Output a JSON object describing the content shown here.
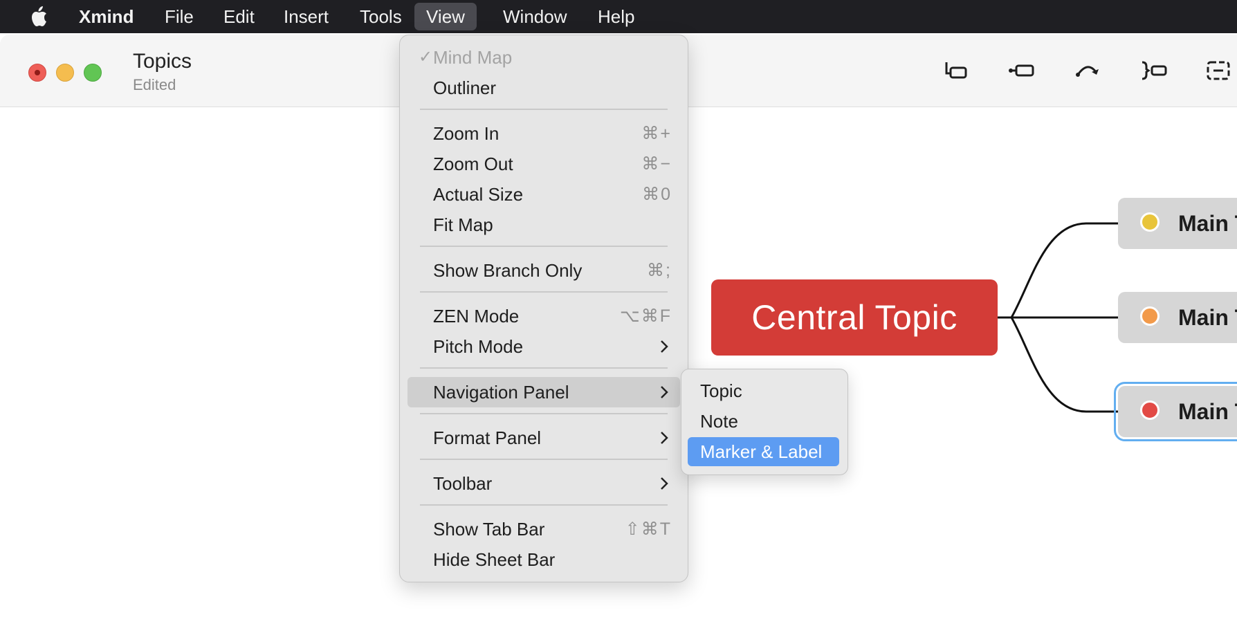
{
  "menubar": {
    "app_name": "Xmind",
    "items": [
      "File",
      "Edit",
      "Insert",
      "Tools",
      "View",
      "Window",
      "Help"
    ],
    "active": "View"
  },
  "window": {
    "title": "Topics",
    "subtitle": "Edited"
  },
  "map": {
    "central_topic": "Central Topic",
    "main_topics": [
      {
        "label": "Main T",
        "marker_color": "#e8c43a"
      },
      {
        "label": "Main T",
        "marker_color": "#f29a4a"
      },
      {
        "label": "Main T",
        "marker_color": "#e24a45"
      }
    ]
  },
  "view_menu": {
    "mind_map": "Mind Map",
    "outliner": "Outliner",
    "zoom_in": "Zoom In",
    "zoom_in_sc": "⌘+",
    "zoom_out": "Zoom Out",
    "zoom_out_sc": "⌘−",
    "actual_size": "Actual Size",
    "actual_size_sc": "⌘0",
    "fit_map": "Fit Map",
    "show_branch_only": "Show Branch Only",
    "show_branch_only_sc": "⌘;",
    "zen_mode": "ZEN Mode",
    "zen_mode_sc": "⌥⌘F",
    "pitch_mode": "Pitch Mode",
    "navigation_panel": "Navigation Panel",
    "format_panel": "Format Panel",
    "toolbar": "Toolbar",
    "show_tab_bar": "Show Tab Bar",
    "show_tab_bar_sc": "⇧⌘T",
    "hide_sheet_bar": "Hide Sheet Bar"
  },
  "navigation_submenu": {
    "topic": "Topic",
    "note": "Note",
    "marker_label": "Marker & Label"
  },
  "colors": {
    "central": "#d33c37",
    "selection": "#5d9cf2"
  }
}
